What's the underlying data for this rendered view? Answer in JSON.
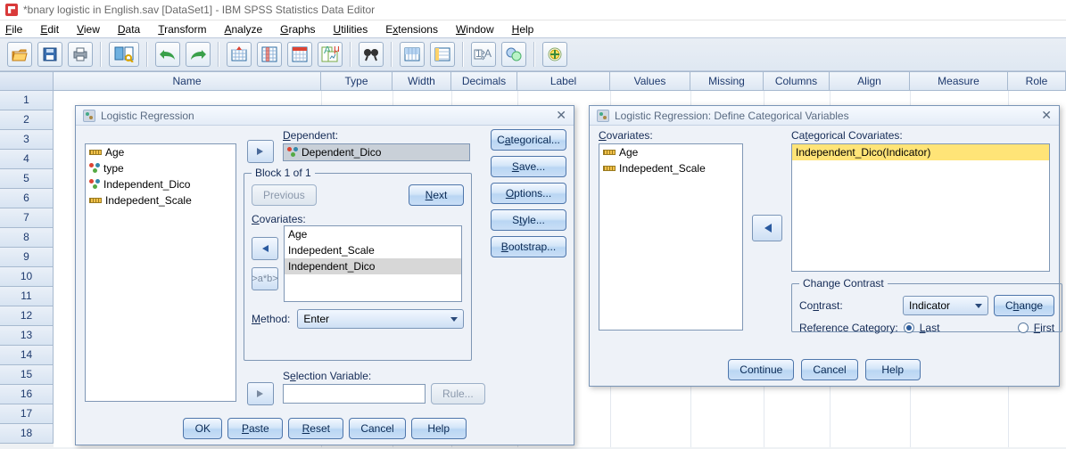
{
  "window": {
    "title": "*bnary logistic in English.sav [DataSet1] - IBM SPSS Statistics Data Editor"
  },
  "menu": {
    "file": "File",
    "edit": "Edit",
    "view": "View",
    "data": "Data",
    "transform": "Transform",
    "analyze": "Analyze",
    "graphs": "Graphs",
    "utilities": "Utilities",
    "extensions": "Extensions",
    "window": "Window",
    "help": "Help"
  },
  "columns": {
    "name": "Name",
    "type": "Type",
    "width": "Width",
    "decimals": "Decimals",
    "label": "Label",
    "values": "Values",
    "missing": "Missing",
    "columns": "Columns",
    "align": "Align",
    "measure": "Measure",
    "role": "Role"
  },
  "row_count": 18,
  "dlg1": {
    "title": "Logistic Regression",
    "vars": [
      "Age",
      "type",
      "Independent_Dico",
      "Indepedent_Scale"
    ],
    "var_icons": [
      "ruler",
      "nominal",
      "nominal",
      "ruler"
    ],
    "dependent_label": "Dependent:",
    "dependent_value": "Dependent_Dico",
    "block_label": "Block 1 of 1",
    "previous": "Previous",
    "next": "Next",
    "covariates_label": "Covariates:",
    "covariates": [
      "Age",
      "Indepedent_Scale",
      "Independent_Dico"
    ],
    "interaction": ">a*b>",
    "method_label": "Method:",
    "method_value": "Enter",
    "selection_label": "Selection Variable:",
    "rule": "Rule...",
    "side": {
      "categorical": "Categorical...",
      "save": "Save...",
      "options": "Options...",
      "style": "Style...",
      "bootstrap": "Bootstrap..."
    },
    "bottom": {
      "ok": "OK",
      "paste": "Paste",
      "reset": "Reset",
      "cancel": "Cancel",
      "help": "Help"
    }
  },
  "dlg2": {
    "title": "Logistic Regression: Define Categorical Variables",
    "covariates_label": "Covariates:",
    "covariates": [
      "Age",
      "Indepedent_Scale"
    ],
    "cov_icons": [
      "ruler",
      "ruler"
    ],
    "catcov_label": "Categorical Covariates:",
    "catcov": [
      "Independent_Dico(Indicator)"
    ],
    "change_contrast_label": "Change Contrast",
    "contrast_label": "Contrast:",
    "contrast_value": "Indicator",
    "change": "Change",
    "refcat_label": "Reference Category:",
    "last": "Last",
    "first": "First",
    "continue": "Continue",
    "cancel": "Cancel",
    "help": "Help"
  }
}
